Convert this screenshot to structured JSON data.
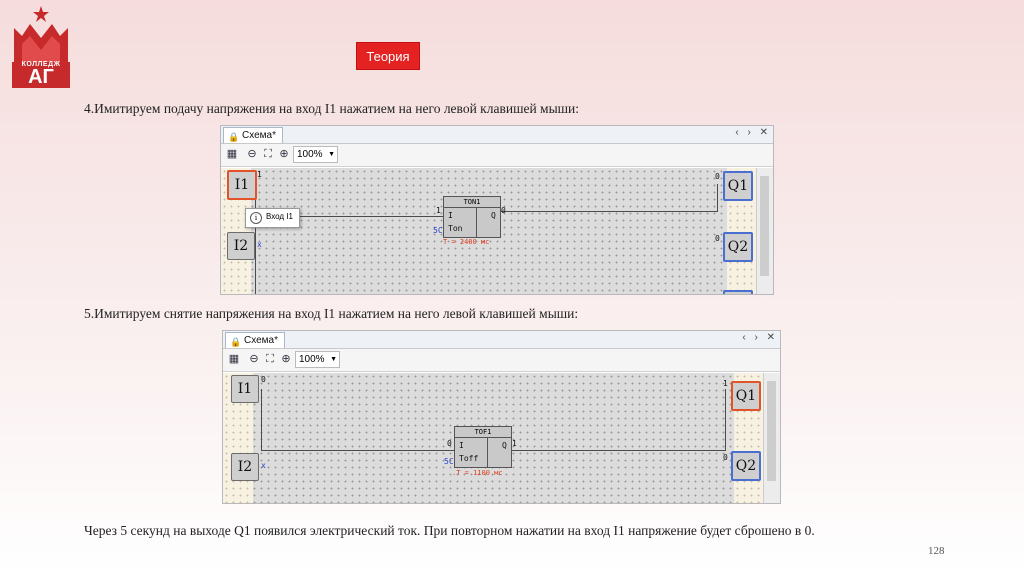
{
  "logo": {
    "college": "КОЛЛЕДЖ",
    "letters": "АГ"
  },
  "theory_button": "Теория",
  "caption1": "4.Имитируем подачу напряжения на вход I1 нажатием на него левой клавишей мыши:",
  "caption2": "5.Имитируем снятие напряжения на вход I1 нажатием на него левой клавишей мыши:",
  "caption3": "Через 5 секунд на выходе Q1 появился электрический ток.  При повторном нажатии на вход I1 напряжение будет сброшено в 0.",
  "page_number": "128",
  "panel1": {
    "tab": "Схема*",
    "zoom": "100%",
    "inputs": [
      {
        "label": "I1",
        "pin": "1"
      },
      {
        "label": "I2",
        "pin": "x"
      }
    ],
    "outputs": [
      {
        "label": "Q1",
        "pin": "0"
      },
      {
        "label": "Q2",
        "pin": "0"
      }
    ],
    "block": {
      "name": "TON1",
      "in_label": "I",
      "out_label": "Q",
      "param": "Ton",
      "in_pin": "1",
      "out_pin": "0",
      "param_pin": "5C",
      "time": "T = 2400 мс"
    },
    "tooltip": "Вход I1"
  },
  "panel2": {
    "tab": "Схема*",
    "zoom": "100%",
    "inputs": [
      {
        "label": "I1",
        "pin": "0"
      },
      {
        "label": "I2",
        "pin": "x"
      }
    ],
    "outputs": [
      {
        "label": "Q1",
        "pin": "1"
      },
      {
        "label": "Q2",
        "pin": "0"
      }
    ],
    "block": {
      "name": "TOF1",
      "in_label": "I",
      "out_label": "Q",
      "param": "Toff",
      "in_pin": "0",
      "out_pin": "1",
      "param_pin": "5C",
      "time": ".T = 1100 мс"
    }
  },
  "colors": {
    "active": "#e0532b",
    "accent": "#e42222",
    "output_border": "#4a6fd0"
  }
}
